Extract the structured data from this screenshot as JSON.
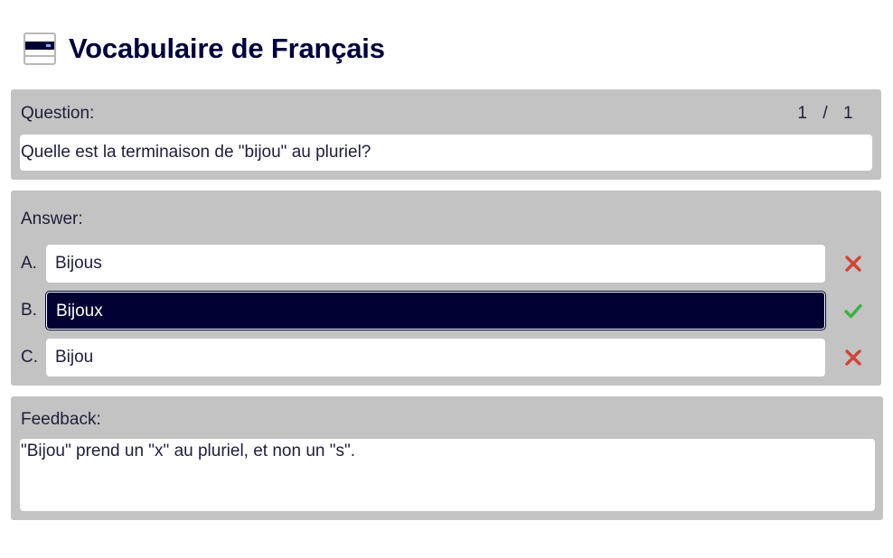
{
  "app": {
    "title": "Vocabulaire de Français",
    "icon": "card-icon"
  },
  "question": {
    "label": "Question:",
    "current": "1",
    "separator": "/",
    "total": "1",
    "text": "Quelle est la terminaison de \"bijou\" au pluriel?"
  },
  "answer": {
    "label": "Answer:",
    "options": [
      {
        "letter": "A.",
        "text": "Bijous",
        "selected": false,
        "result": "incorrect",
        "mark_icon": "cross-icon"
      },
      {
        "letter": "B.",
        "text": "Bijoux",
        "selected": true,
        "result": "correct",
        "mark_icon": "check-icon"
      },
      {
        "letter": "C.",
        "text": "Bijou",
        "selected": false,
        "result": "incorrect",
        "mark_icon": "cross-icon"
      }
    ]
  },
  "feedback": {
    "label": "Feedback:",
    "text": "\"Bijou\" prend un \"x\" au pluriel, et non un \"s\"."
  },
  "colors": {
    "panel_bg": "#c3c3c3",
    "selected_bg": "#000033",
    "correct": "#3cb043",
    "incorrect": "#d0443a",
    "title": "#00003a"
  }
}
